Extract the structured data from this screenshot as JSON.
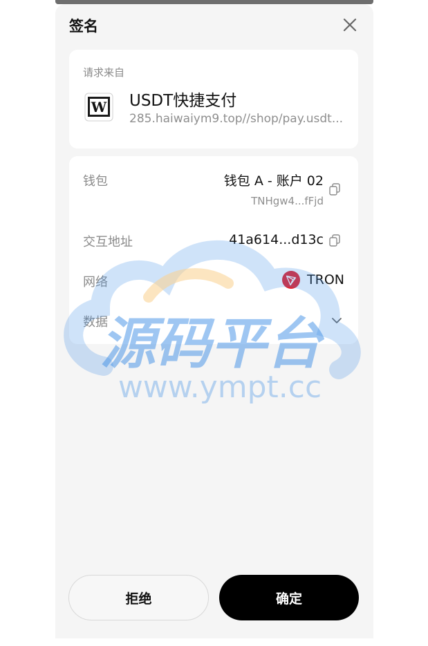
{
  "header": {
    "title": "签名",
    "close_icon": "close-icon"
  },
  "request": {
    "label": "请求来自",
    "app_name": "USDT快捷支付",
    "app_url": "285.haiwaiym9.top//shop/pay.usdt...",
    "logo_letter": "W"
  },
  "details": {
    "wallet_label": "钱包",
    "wallet_name": "钱包 A - 账户 02",
    "wallet_address": "TNHgw4...fFjd",
    "contract_label": "交互地址",
    "contract_address": "41a614...d13c",
    "network_label": "网络",
    "network_name": "TRON",
    "data_label": "数据"
  },
  "watermark": {
    "title": "源码平台",
    "url": "www.ympt.cc"
  },
  "actions": {
    "reject_label": "拒绝",
    "confirm_label": "确定"
  },
  "colors": {
    "tron_red": "#e5202b",
    "confirm_bg": "#000000",
    "watermark_blue": "#3f8fe6",
    "watermark_orange": "#f5b041"
  }
}
